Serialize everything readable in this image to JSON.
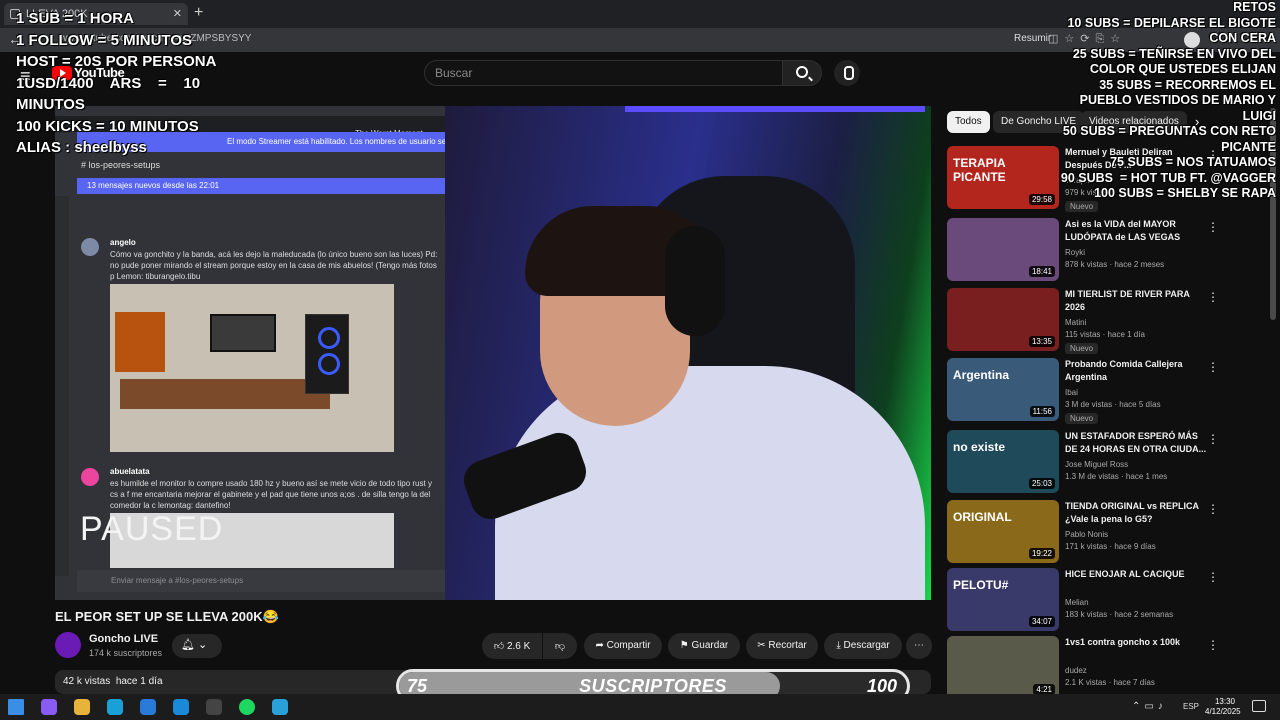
{
  "browser": {
    "tab_title": "LLEVA 200K",
    "url": "ww.youtube.com/watch?v=qgZMPSBYSYY",
    "reading_label": "Resumir"
  },
  "youtube": {
    "logo_text": "YouTube",
    "search_placeholder": "Buscar"
  },
  "discord": {
    "top_label": "The Worst Moment",
    "banner": "El modo Streamer está habilitado. Los nombres de usuario se ha",
    "channel": "# los-peores-setups",
    "new_messages": "13 mensajes nuevos desde las 22:01",
    "msg1_author": "angelo",
    "msg1_text": "Cómo va gonchito y la banda, acá les dejo la maleducada (lo único bueno son las luces) Pd: no pude poner mirando el stream porque estoy en la casa de mis abuelos! (Tengo más fotos p Lemon: tiburangelo.tibu",
    "msg2_author": "abuelatata",
    "msg2_text": "es humilde el monitor lo compre usado 180 hz y bueno así se mete vicio de todo tipo rust y cs a f me encantaria mejorar el gabinete y el pad que tiene unos a;os . de silla tengo la del comedor la c lemontag: dantefino!",
    "input_placeholder": "Enviar mensaje a #los-peores-setups"
  },
  "video": {
    "paused_label": "PAUSED",
    "title": "EL PEOR SET UP SE LLEVA 200K😂",
    "views": "42 k vistas",
    "date": "hace 1 día"
  },
  "channel": {
    "name": "Goncho LIVE",
    "subscribers": "174 k suscriptores"
  },
  "actions": {
    "likes": "2.6 K",
    "share": "Compartir",
    "save": "Guardar",
    "clip": "Recortar",
    "download": "Descargar"
  },
  "chips": [
    "Todos",
    "De Goncho LIVE",
    "Videos relacionados"
  ],
  "recommendations": [
    {
      "title": "Mernuel y Bauleti Deliran Después De P...",
      "channel": "Terap...",
      "views": "979 k vistas",
      "age": "",
      "duration": "29:58",
      "badge": "Nuevo",
      "thumb_color": "#b3261e",
      "thumb_text": "TERAPIA PICANTE"
    },
    {
      "title": "Asi es la VIDA del MAYOR LUDÓPATA de LAS VEGAS",
      "channel": "Royki",
      "views": "878 k vistas",
      "age": "hace 2 meses",
      "duration": "18:41",
      "badge": "",
      "thumb_color": "#6a4a7a",
      "thumb_text": ""
    },
    {
      "title": "MI TIERLIST DE RIVER PARA 2026",
      "channel": "Matini",
      "views": "115 vistas",
      "age": "hace 1 día",
      "duration": "13:35",
      "badge": "Nuevo",
      "thumb_color": "#7a1f1f",
      "thumb_text": ""
    },
    {
      "title": "Probando Comida Callejera Argentina",
      "channel": "Ibai",
      "views": "3 M de vistas",
      "age": "hace 5 días",
      "duration": "11:56",
      "badge": "Nuevo",
      "thumb_color": "#3a5a7a",
      "thumb_text": "Argentina"
    },
    {
      "title": "UN ESTAFADOR ESPERÓ MÁS DE 24 HORAS EN OTRA CIUDA...",
      "channel": "Jose Miguel Ross",
      "views": "1.3 M de vistas",
      "age": "hace 1 mes",
      "duration": "25:03",
      "badge": "",
      "thumb_color": "#1f4a5a",
      "thumb_text": "no existe"
    },
    {
      "title": "TIENDA ORIGINAL vs REPLICA ¿Vale la pena lo G5?",
      "channel": "Pablo Nonis",
      "views": "171 k vistas",
      "age": "hace 9 días",
      "duration": "19:22",
      "badge": "",
      "thumb_color": "#8a6a1a",
      "thumb_text": "ORIGINAL"
    },
    {
      "title": "HICE ENOJAR AL CACIQUE",
      "channel": "Melian",
      "views": "183 k vistas",
      "age": "hace 2 semanas",
      "duration": "34:07",
      "badge": "",
      "thumb_color": "#3a3a6a",
      "thumb_text": "PELOTU#"
    },
    {
      "title": "1vs1 contra goncho x 100k",
      "channel": "dudez",
      "views": "2.1 K vistas",
      "age": "hace 7 días",
      "duration": "4:21",
      "badge": "",
      "thumb_color": "#5a5a4a",
      "thumb_text": ""
    }
  ],
  "overlay_left": [
    "1 SUB = 1 HORA",
    "1 FOLLOW = 5 MINUTOS",
    "HOST = 20S POR PERSONA",
    "1USD/1400    ARS    =    10",
    "MINUTOS",
    "100 KICKS = 10 MINUTOS",
    "ALIAS : sheelbyss"
  ],
  "overlay_right": [
    "RETOS",
    "10 SUBS = DEPILARSE EL BIGOTE",
    "CON CERA",
    "25 SUBS = TEÑIRSE EN VIVO DEL",
    "COLOR QUE USTEDES ELIJAN",
    "35 SUBS = RECORREMOS EL",
    "PUEBLO VESTIDOS DE MARIO Y",
    "LUIGI",
    "50 SUBS = PREGUNTAS CON RETO",
    "PICANTE",
    "75 SUBS = NOS TATUAMOS",
    "90 SUBS  = HOT TUB FT. @VAGGER",
    "100 SUBS = SHELBY SE RAPA"
  ],
  "goal": {
    "start": "75",
    "label": "SUSCRIPTORES",
    "end": "100",
    "progress": 0.75
  },
  "taskbar": {
    "lang": "ESP",
    "time": "13:30",
    "date": "4/12/2025",
    "icons": [
      {
        "name": "windows-icon",
        "color": "#3a8ee6"
      },
      {
        "name": "copilot-icon",
        "color": "#8a5cf6"
      },
      {
        "name": "file-explorer-icon",
        "color": "#e8b33a"
      },
      {
        "name": "edge-icon",
        "color": "#1aa0d8"
      },
      {
        "name": "edge-active-icon",
        "color": "#2a7ad8"
      },
      {
        "name": "f-app-icon",
        "color": "#1a8ad8"
      },
      {
        "name": "obs-icon",
        "color": "#444444"
      },
      {
        "name": "spotify-icon",
        "color": "#1ed760"
      },
      {
        "name": "app-icon",
        "color": "#2aa0d8"
      }
    ]
  }
}
